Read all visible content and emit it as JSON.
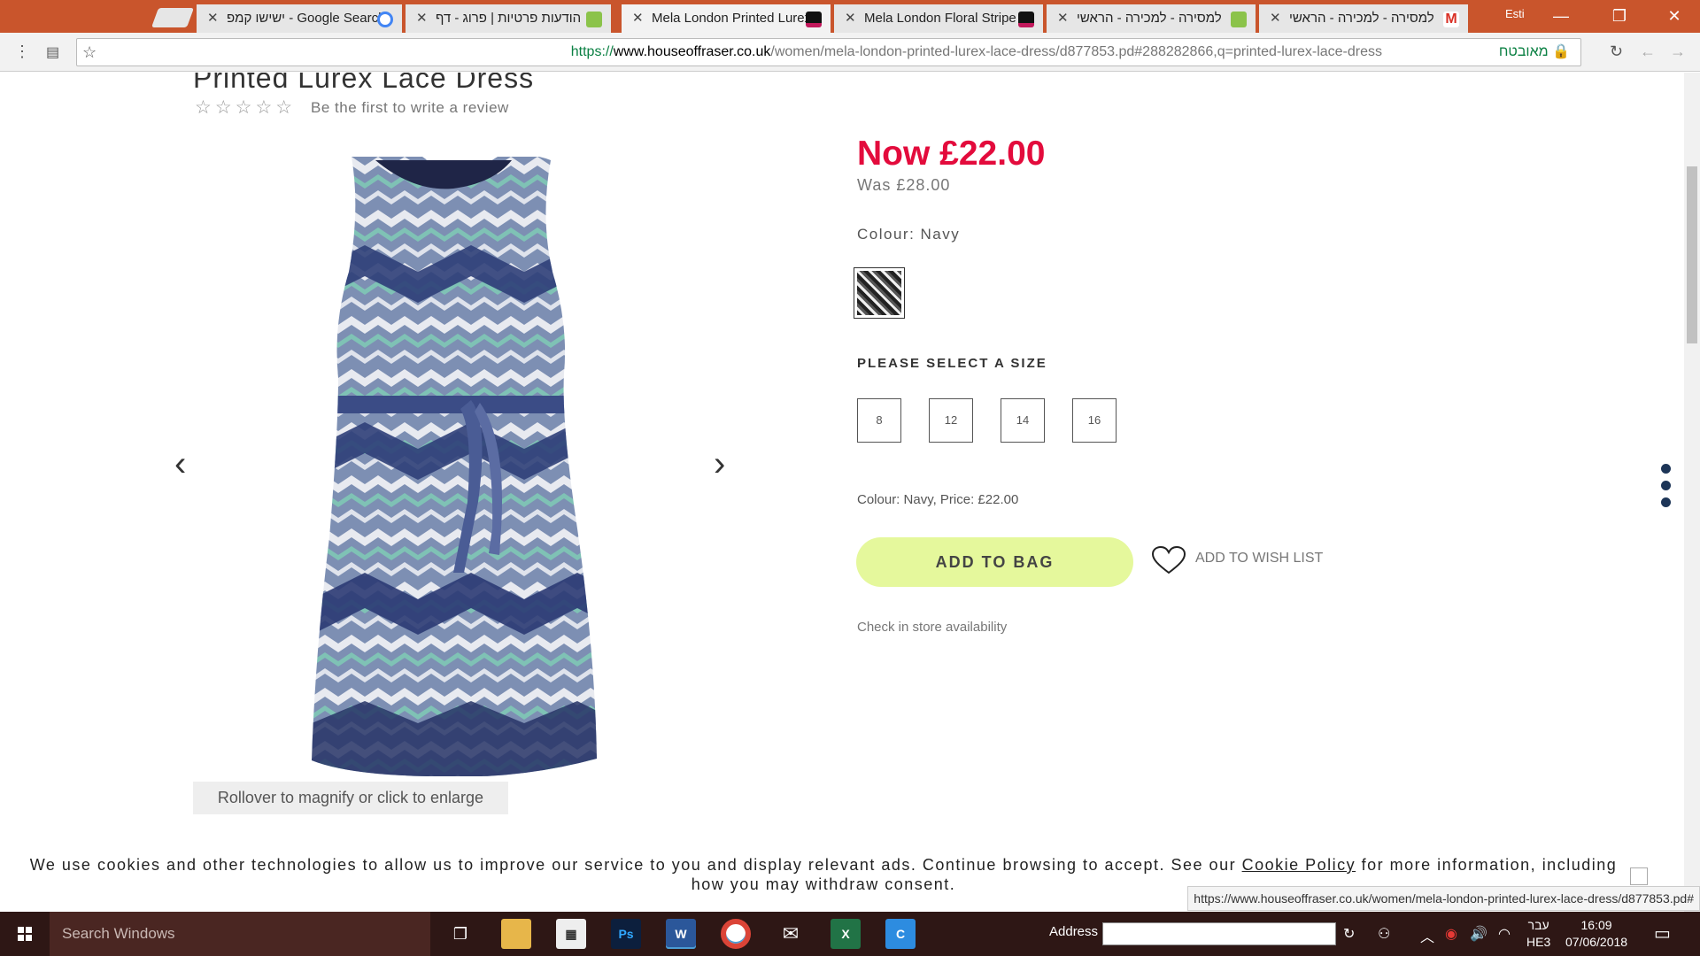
{
  "browser": {
    "tabs": [
      {
        "label": "ישישו קמפ - Google Search",
        "favicon_color": "#4285f4"
      },
      {
        "label": "הודעות פרטיות | פרוג - דף",
        "favicon_color": "#8bc34a"
      },
      {
        "label": "Mela London Printed Lurex",
        "favicon_color": "#111111"
      },
      {
        "label": "Mela London Floral Stripe",
        "favicon_color": "#111111"
      },
      {
        "label": "למסירה - למכירה - הראשי",
        "favicon_color": "#8bc34a"
      },
      {
        "label": "למסירה - למכירה - הראשי",
        "favicon_color": "#d93025"
      }
    ],
    "user_label": "Esti",
    "url_scheme": "https://",
    "url_host": "www.houseoffraser.co.uk",
    "url_path": "/women/mela-london-printed-lurex-lace-dress/d877853.pd#288282866,q=printed-lurex-lace-dress",
    "secure_label": "מאובטח",
    "status_url": "https://www.houseoffraser.co.uk/women/mela-london-printed-lurex-lace-dress/d877853.pd#"
  },
  "product": {
    "title": "Printed Lurex Lace Dress",
    "stars": "☆☆☆☆☆",
    "review_link": "Be the first to write a review",
    "price_now": "Now £22.00",
    "price_was": "Was £28.00",
    "colour_label": "Colour: Navy",
    "size_heading": "PLEASE SELECT A SIZE",
    "sizes": [
      "8",
      "12",
      "14",
      "16"
    ],
    "variant_summary": "Colour: Navy, Price: £22.00",
    "add_to_bag": "ADD TO BAG",
    "wish_list": "ADD TO WISH LIST",
    "store_check": "Check in store availability",
    "magnify_hint": "Rollover to magnify or click to enlarge",
    "accent_color": "#e30b3c",
    "button_color": "#e5f89c"
  },
  "cookie": {
    "text_before": "We use cookies and other technologies to allow us to improve our service to you and display relevant ads. Continue browsing to accept. See our ",
    "link": "Cookie Policy",
    "text_after": " for more information, including how you may withdraw consent."
  },
  "taskbar": {
    "search_placeholder": "Search Windows",
    "address_label": "Address",
    "lang_top": "עבר",
    "lang_bottom": "HE3",
    "time": "16:09",
    "date": "07/06/2018"
  }
}
